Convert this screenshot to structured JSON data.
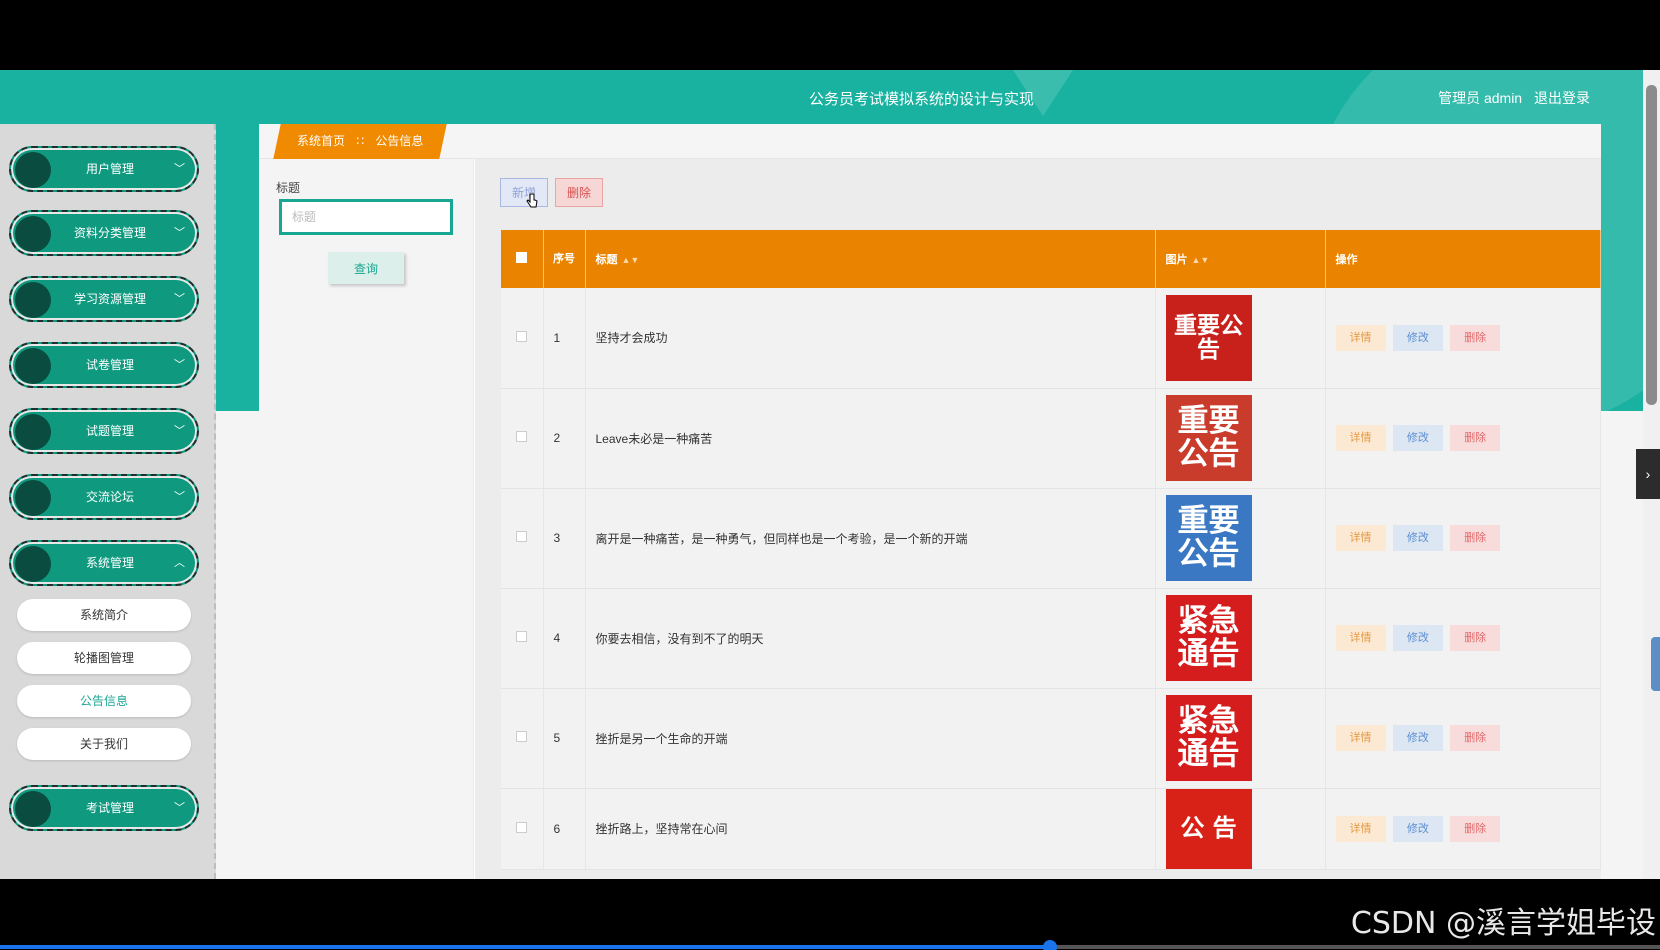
{
  "header": {
    "title": "公务员考试模拟系统的设计与实现",
    "user_label": "管理员 admin",
    "logout": "退出登录"
  },
  "sidebar": {
    "menus": [
      {
        "label": "用户管理",
        "chevron": "chevron-down-icon"
      },
      {
        "label": "资料分类管理",
        "chevron": "chevron-down-icon"
      },
      {
        "label": "学习资源管理",
        "chevron": "chevron-down-icon"
      },
      {
        "label": "试卷管理",
        "chevron": "chevron-down-icon"
      },
      {
        "label": "试题管理",
        "chevron": "chevron-down-icon"
      },
      {
        "label": "交流论坛",
        "chevron": "chevron-down-icon"
      },
      {
        "label": "系统管理",
        "chevron": "chevron-up-icon"
      },
      {
        "label": "考试管理",
        "chevron": "chevron-down-icon"
      }
    ],
    "submenu": [
      "系统简介",
      "轮播图管理",
      "公告信息",
      "关于我们"
    ],
    "active_submenu": "公告信息"
  },
  "breadcrumb": {
    "home": "系统首页",
    "separator": "∷",
    "current": "公告信息"
  },
  "search": {
    "label": "标题",
    "placeholder": "标题",
    "button": "查询"
  },
  "toolbar": {
    "add": "新增",
    "delete": "删除"
  },
  "table": {
    "headers": {
      "index": "序号",
      "title": "标题",
      "image": "图片",
      "actions": "操作"
    },
    "actions": {
      "detail": "详情",
      "edit": "修改",
      "delete": "删除"
    },
    "rows": [
      {
        "index": "1",
        "title": "坚持才会成功",
        "image_text": "重要公告",
        "image_bg": "#c8211b"
      },
      {
        "index": "2",
        "title": "Leave未必是一种痛苦",
        "image_text": "重要公告",
        "image_bg": "#c93b2b"
      },
      {
        "index": "3",
        "title": "离开是一种痛苦，是一种勇气，但同样也是一个考验，是一个新的开端",
        "image_text": "重要公告",
        "image_bg": "#3a78c4"
      },
      {
        "index": "4",
        "title": "你要去相信，没有到不了的明天",
        "image_text": "紧急通告",
        "image_bg": "#d61d1d"
      },
      {
        "index": "5",
        "title": "挫折是另一个生命的开端",
        "image_text": "紧急通告",
        "image_bg": "#d61d1d"
      },
      {
        "index": "6",
        "title": "挫折路上，坚持常在心间",
        "image_text": "公 告",
        "image_bg": "#d82218"
      }
    ]
  },
  "watermark": "CSDN @溪言学姐毕设",
  "colors": {
    "teal": "#19b2a0",
    "orange": "#ea8400",
    "menu_green": "#0f9a80"
  }
}
